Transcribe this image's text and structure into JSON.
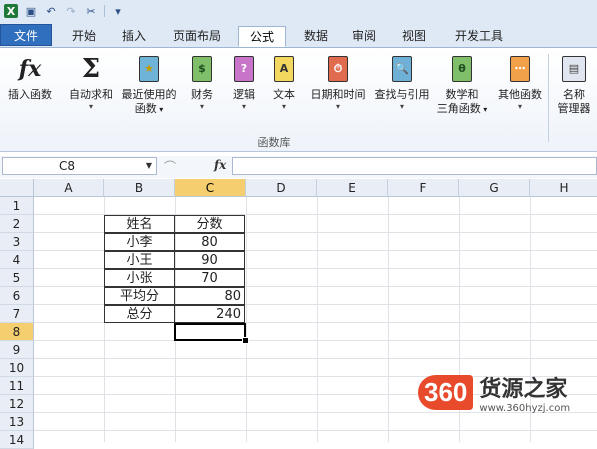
{
  "qat": {
    "icons": [
      "excel-logo-icon",
      "save-icon",
      "undo-icon",
      "redo-icon",
      "customize-icon"
    ]
  },
  "tabs": [
    {
      "id": "file",
      "label": "文件"
    },
    {
      "id": "home",
      "label": "开始"
    },
    {
      "id": "insert",
      "label": "插入"
    },
    {
      "id": "layout",
      "label": "页面布局"
    },
    {
      "id": "formulas",
      "label": "公式"
    },
    {
      "id": "data",
      "label": "数据"
    },
    {
      "id": "review",
      "label": "审阅"
    },
    {
      "id": "view",
      "label": "视图"
    },
    {
      "id": "developer",
      "label": "开发工具"
    }
  ],
  "ribbon": {
    "insert_function": "插入函数",
    "autosum_label": "自动求和",
    "recent_line1": "最近使用的",
    "recent_line2": "函数",
    "financial": "财务",
    "logical": "逻辑",
    "text": "文本",
    "datetime": "日期和时间",
    "lookup": "查找与引用",
    "math_line1": "数学和",
    "math_line2": "三角函数",
    "other": "其他函数",
    "name_mgr_line1": "名称",
    "name_mgr_line2": "管理器",
    "group_label": "函数库",
    "dropdown": "▾",
    "book_glyphs": {
      "financial": "$",
      "logical": "?",
      "text": "A",
      "datetime": "⏱",
      "lookup": "🔍",
      "math": "θ",
      "other": "⋯"
    }
  },
  "formula_bar": {
    "cell_ref": "C8",
    "fx": "fx",
    "value": ""
  },
  "sheet": {
    "columns": [
      "A",
      "B",
      "C",
      "D",
      "E",
      "F",
      "G",
      "H"
    ],
    "rows": [
      "1",
      "2",
      "3",
      "4",
      "5",
      "6",
      "7",
      "8",
      "9",
      "10",
      "11",
      "12",
      "13",
      "14"
    ],
    "selected_column": "C",
    "selected_row": "8",
    "table": [
      {
        "b": "姓名",
        "c": "分数"
      },
      {
        "b": "小李",
        "c": "80"
      },
      {
        "b": "小王",
        "c": "90"
      },
      {
        "b": "小张",
        "c": "70"
      },
      {
        "b": "平均分",
        "c": "80"
      },
      {
        "b": "总分",
        "c": "240"
      }
    ]
  },
  "watermark": {
    "badge": "360",
    "title": "货源之家",
    "url": "www.360hyzj.com"
  }
}
